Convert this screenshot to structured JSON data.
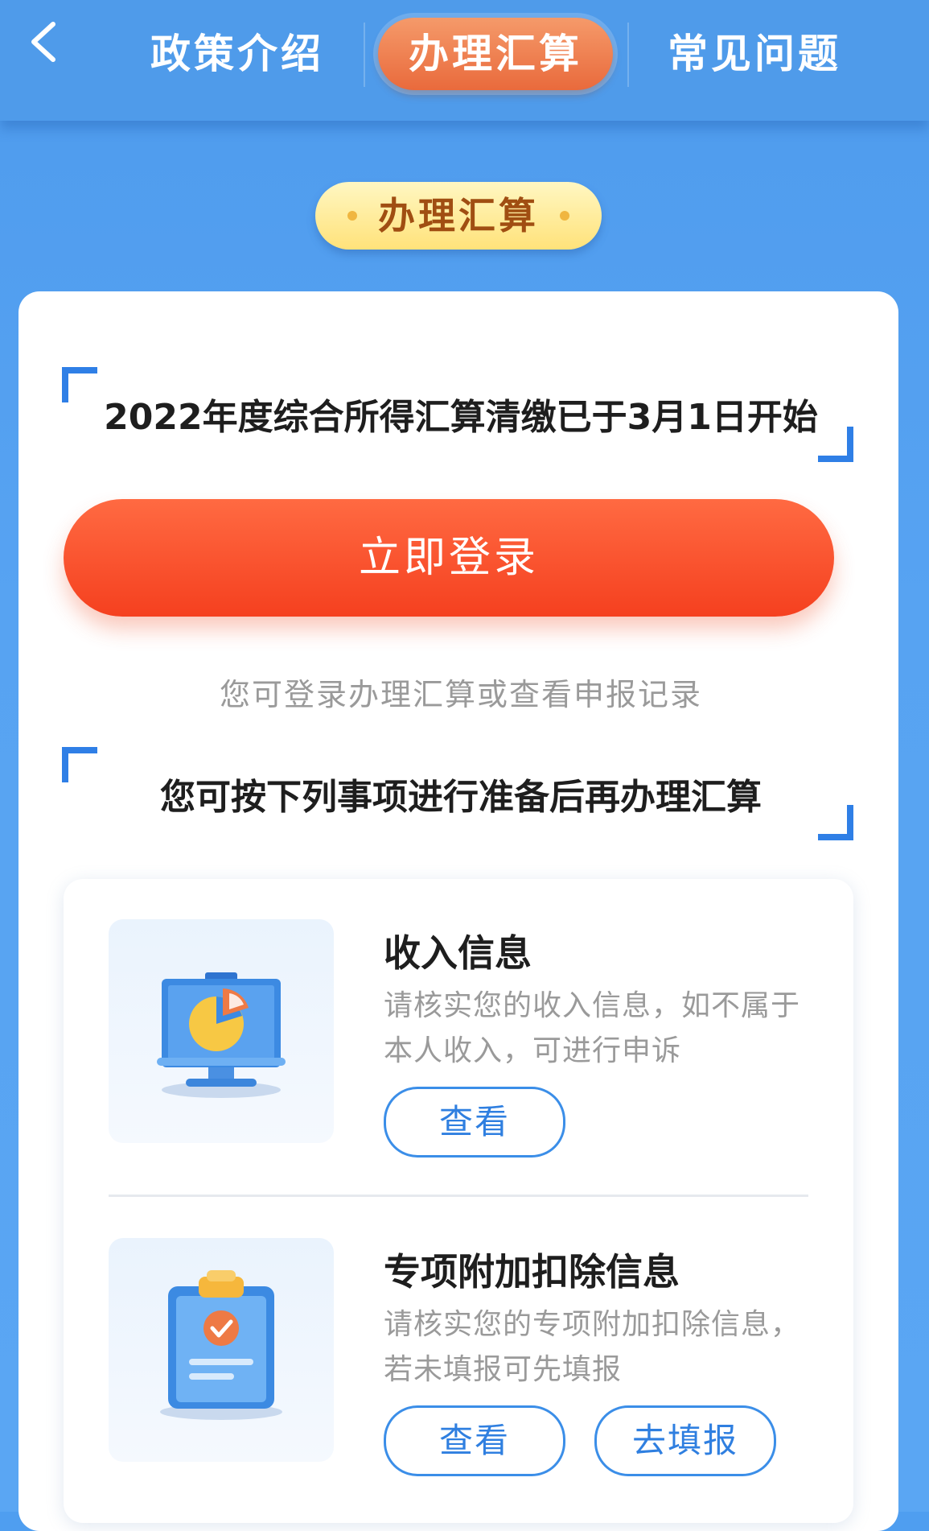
{
  "nav": {
    "tabs": [
      {
        "label": "政策介绍",
        "active": false
      },
      {
        "label": "办理汇算",
        "active": true
      },
      {
        "label": "常见问题",
        "active": false
      }
    ]
  },
  "section_pill": "办理汇算",
  "card": {
    "headline": "2022年度综合所得汇算清缴已于3月1日开始",
    "login_button": "立即登录",
    "login_hint": "您可登录办理汇算或查看申报记录",
    "prep_title": "您可按下列事项进行准备后再办理汇算"
  },
  "items": [
    {
      "title": "收入信息",
      "desc_line1": "请核实您的收入信息，如不属于",
      "desc_line2": "本人收入，可进行申诉",
      "icon": "presentation-pie-chart-icon",
      "buttons": [
        "查看"
      ]
    },
    {
      "title": "专项附加扣除信息",
      "desc_line1": "请核实您的专项附加扣除信息，",
      "desc_line2": "若未填报可先填报",
      "icon": "clipboard-check-icon",
      "buttons": [
        "查看",
        "去填报"
      ]
    }
  ],
  "colors": {
    "background": "#4f9ef0",
    "active_tab": "#e96a3c",
    "login_button": "#f5401f",
    "accent_blue": "#2f7fe6",
    "pill_bg": "#ffe27a",
    "pill_text": "#a04e12"
  }
}
